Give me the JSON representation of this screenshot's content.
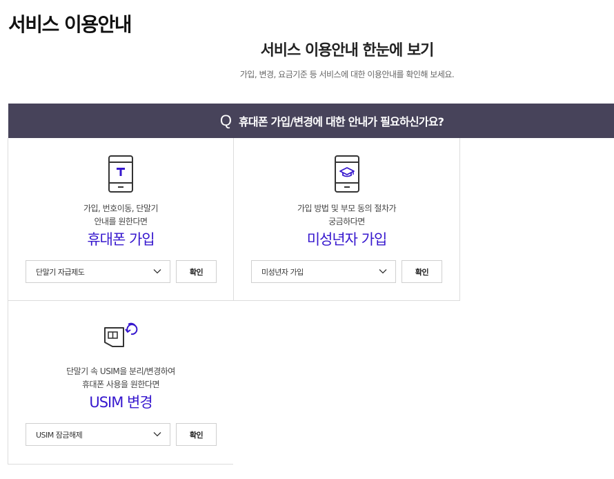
{
  "page": {
    "title": "서비스 이용안내"
  },
  "section": {
    "title": "서비스 이용안내 한눈에 보기",
    "subtitle": "가입, 변경, 요금기준 등 서비스에 대한 이용안내를 확인해 보세요."
  },
  "question": {
    "mark": "Q",
    "text": "휴대폰 가입/변경에 대한 안내가 필요하신가요?"
  },
  "cards": [
    {
      "desc_line1": "가입, 번호이동, 단말기",
      "desc_line2": "안내를 원한다면",
      "service": "휴대폰 가입",
      "select_value": "단말기 자급제도",
      "button": "확인",
      "icon": "phone-t-icon"
    },
    {
      "desc_line1": "가입 방법 및 부모 동의 절차가",
      "desc_line2": "궁금하다면",
      "service": "미성년자 가입",
      "select_value": "미성년자 가입",
      "button": "확인",
      "icon": "phone-graduation-cap-icon"
    },
    {
      "desc_line1": "단말기 속 USIM을 분리/변경하여",
      "desc_line2": "휴대폰 사용을 원한다면",
      "service": "USIM 변경",
      "select_value": "USIM 잠금해제",
      "button": "확인",
      "icon": "usim-refresh-icon"
    }
  ],
  "colors": {
    "accent": "#3617ce",
    "question_bar": "#47435a"
  }
}
